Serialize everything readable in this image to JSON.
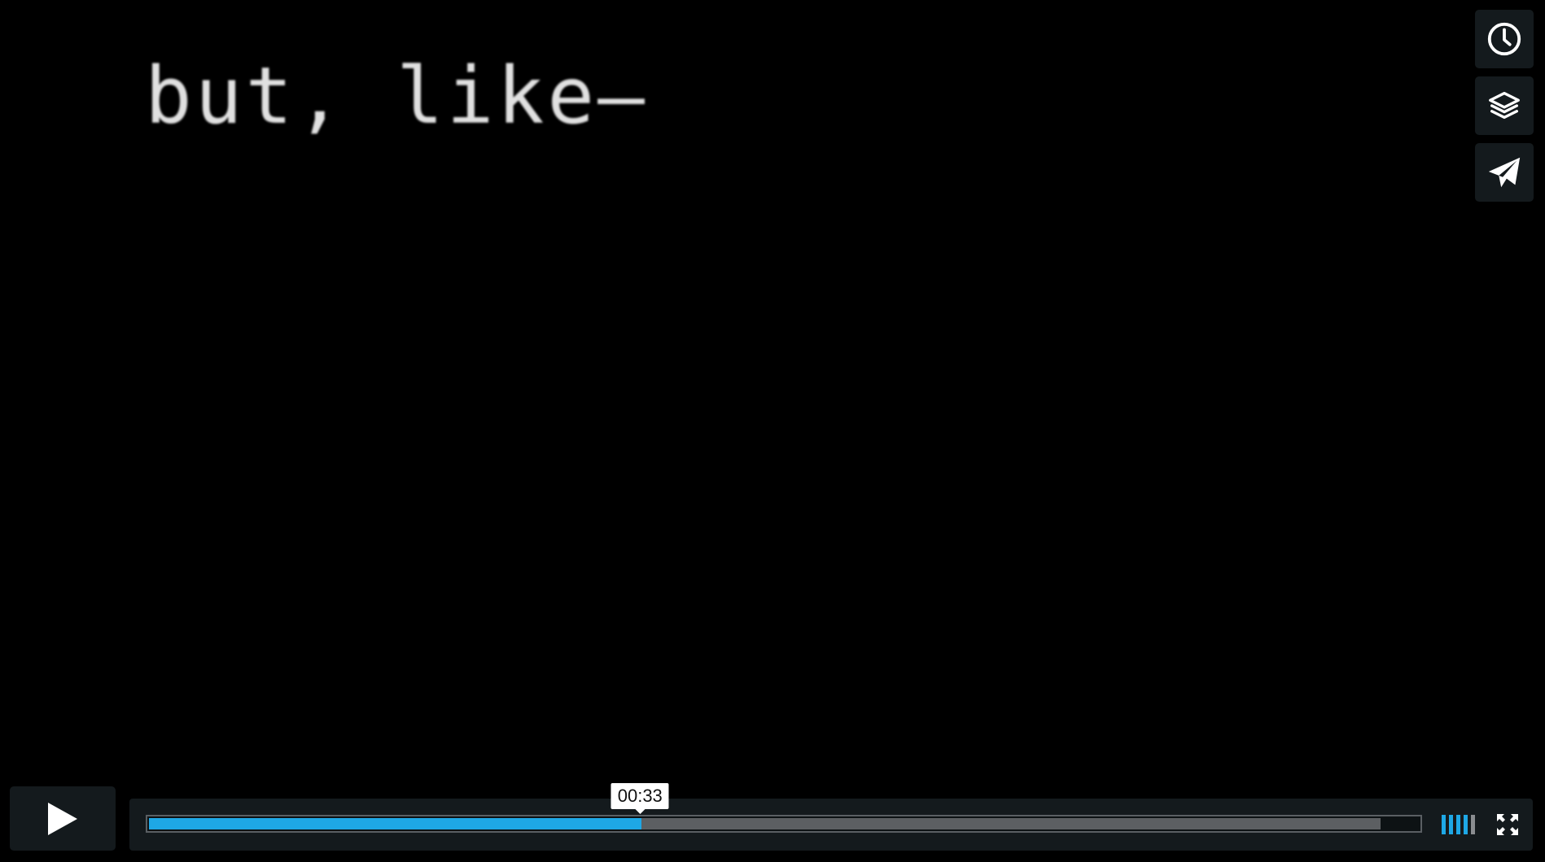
{
  "video": {
    "caption_text": "but, like—"
  },
  "side_actions": [
    {
      "name": "watch-later",
      "icon": "clock-icon"
    },
    {
      "name": "collections",
      "icon": "layers-icon"
    },
    {
      "name": "share",
      "icon": "paper-plane-icon"
    }
  ],
  "player": {
    "play_icon": "play-icon",
    "tooltip_time": "00:33",
    "played_fraction": 0.388,
    "loaded_fraction": 0.97,
    "volume_level": 0.8,
    "volume_bars": 5,
    "fullscreen_icon": "fullscreen-icon"
  },
  "colors": {
    "accent": "#1ea8e6",
    "bar_bg": "#141a1d",
    "loaded": "#5c5f62",
    "volume_off": "#8a8d90"
  }
}
